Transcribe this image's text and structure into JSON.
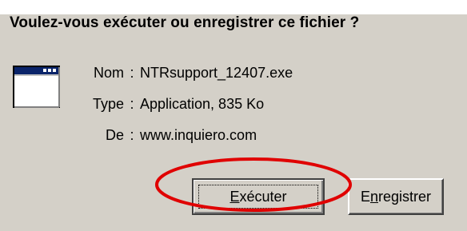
{
  "dialog": {
    "question": "Voulez-vous exécuter ou enregistrer ce fichier ?",
    "cut_caption": "(partial text cut off at top)"
  },
  "file_info": {
    "name_label": "Nom",
    "name_value": "NTRsupport_12407.exe",
    "type_label": "Type",
    "type_value": "Application, 835 Ko",
    "from_label": "De",
    "from_value": "www.inquiero.com",
    "separator": ":"
  },
  "buttons": {
    "run_mnemonic": "E",
    "run_rest": "xécuter",
    "save_first": "E",
    "save_mnemonic": "n",
    "save_rest": "registrer"
  },
  "icons": {
    "file": "application-window-icon"
  },
  "colors": {
    "dialog_background": "#d4d0c8",
    "highlight_ellipse": "#e00000",
    "icon_titlebar": "#0a246a"
  }
}
